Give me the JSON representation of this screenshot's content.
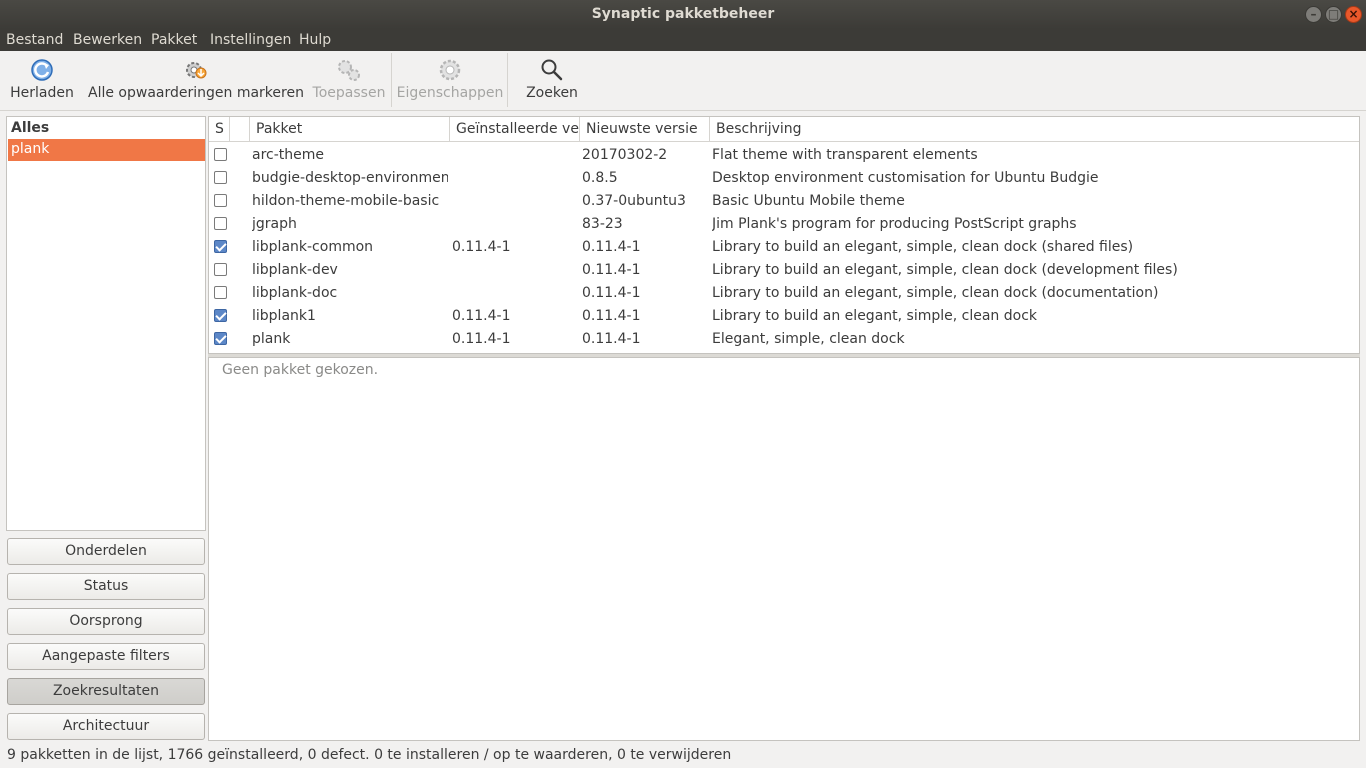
{
  "window": {
    "title": "Synaptic pakketbeheer"
  },
  "menu": [
    "Bestand",
    "Bewerken",
    "Pakket",
    "Instellingen",
    "Hulp"
  ],
  "toolbar": {
    "reload": "Herladen",
    "mark_all": "Alle opwaarderingen markeren",
    "apply": "Toepassen",
    "properties": "Eigenschappen",
    "search": "Zoeken"
  },
  "sidebar": {
    "header": "Alles",
    "selected_item": "plank",
    "buttons": [
      "Onderdelen",
      "Status",
      "Oorsprong",
      "Aangepaste filters",
      "Zoekresultaten",
      "Architectuur"
    ],
    "active_button": "Zoekresultaten"
  },
  "table": {
    "columns": [
      "S",
      "Pakket",
      "Geïnstalleerde vers",
      "Nieuwste versie",
      "Beschrijving"
    ],
    "rows": [
      {
        "checked": false,
        "name": "arc-theme",
        "installed": "",
        "latest": "20170302-2",
        "desc": "Flat theme with transparent elements"
      },
      {
        "checked": false,
        "name": "budgie-desktop-environment",
        "installed": "",
        "latest": "0.8.5",
        "desc": "Desktop environment customisation for Ubuntu Budgie"
      },
      {
        "checked": false,
        "name": "hildon-theme-mobile-basic",
        "installed": "",
        "latest": "0.37-0ubuntu3",
        "desc": "Basic Ubuntu Mobile theme"
      },
      {
        "checked": false,
        "name": "jgraph",
        "installed": "",
        "latest": "83-23",
        "desc": "Jim Plank's program for producing PostScript graphs"
      },
      {
        "checked": true,
        "name": "libplank-common",
        "installed": "0.11.4-1",
        "latest": "0.11.4-1",
        "desc": "Library to build an elegant, simple, clean dock (shared files)"
      },
      {
        "checked": false,
        "name": "libplank-dev",
        "installed": "",
        "latest": "0.11.4-1",
        "desc": "Library to build an elegant, simple, clean dock (development files)"
      },
      {
        "checked": false,
        "name": "libplank-doc",
        "installed": "",
        "latest": "0.11.4-1",
        "desc": "Library to build an elegant, simple, clean dock (documentation)"
      },
      {
        "checked": true,
        "name": "libplank1",
        "installed": "0.11.4-1",
        "latest": "0.11.4-1",
        "desc": "Library to build an elegant, simple, clean dock"
      },
      {
        "checked": true,
        "name": "plank",
        "installed": "0.11.4-1",
        "latest": "0.11.4-1",
        "desc": "Elegant, simple, clean dock"
      }
    ]
  },
  "details": {
    "empty_text": "Geen pakket gekozen."
  },
  "status": "9 pakketten in de lijst, 1766 geïnstalleerd, 0 defect. 0 te installeren / op te waarderen, 0 te verwijderen",
  "colors": {
    "accent": "#f07746",
    "titlebar": "#3c3b37",
    "close": "#e9582b"
  }
}
